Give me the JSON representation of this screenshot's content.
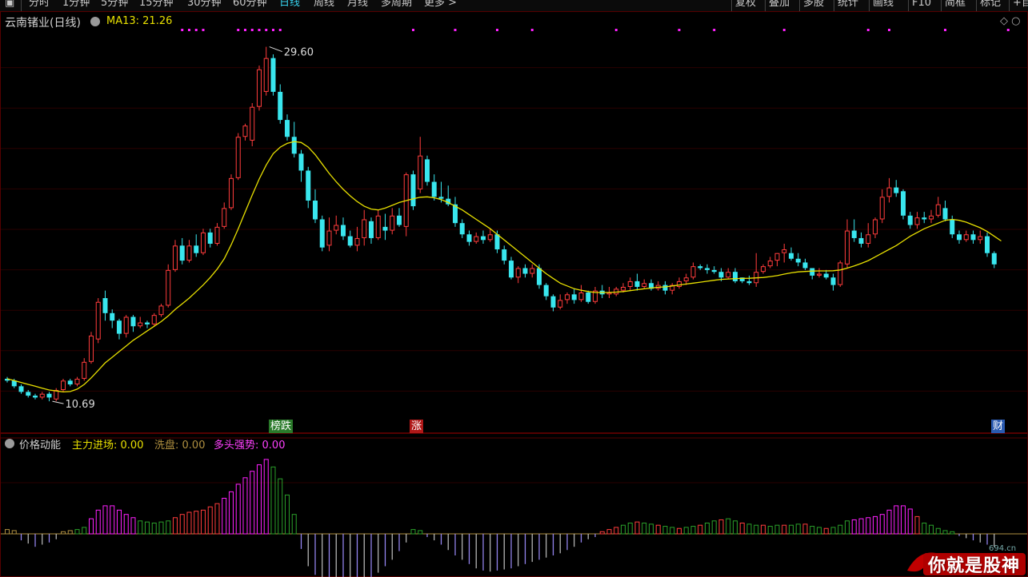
{
  "toolbar": {
    "left_items": [
      "分时",
      "1分钟",
      "5分钟",
      "15分钟",
      "30分钟",
      "60分钟",
      "日线",
      "周线",
      "月线",
      "多周期",
      "更多 >"
    ],
    "active": "日线",
    "right_items": [
      "复权",
      "叠加",
      "多股",
      "统计",
      "画线",
      "F10",
      "简框",
      "标记",
      "+自"
    ]
  },
  "chart": {
    "title": "云南锗业(日线)",
    "ma_label": "MA13: 21.26",
    "high_label": "29.60",
    "low_label": "10.69",
    "y_range": [
      9.0,
      31.5
    ],
    "colors": {
      "up": "#ff3c3c",
      "down": "#39e6ee",
      "ma": "#e8e000",
      "dot": "#ff20ff",
      "bg": "#000000",
      "grid": "#2a0000"
    },
    "corner_icons": "◇ ○"
  },
  "badges": [
    {
      "text": "榜跌",
      "bg": "#2a7a2a"
    },
    {
      "text": "涨",
      "bg": "#b01818"
    },
    {
      "text": "财",
      "bg": "#2a5ab0"
    }
  ],
  "indicator": {
    "name": "价格动能",
    "items": [
      {
        "label": "主力进场:",
        "value": "0.00",
        "color": "#e8e000"
      },
      {
        "label": "洗盘:",
        "value": "0.00",
        "color": "#b09040"
      },
      {
        "label": "多头强势:",
        "value": "0.00",
        "color": "#ff40ff"
      }
    ]
  },
  "chart_data": {
    "type": "candlestick",
    "title": "云南锗业(日线)",
    "series": [
      {
        "name": "MA13",
        "last": 21.26
      }
    ],
    "annotations": {
      "max": 29.6,
      "min": 10.69
    },
    "candles": [
      [
        11.9,
        11.8,
        12.0,
        11.7
      ],
      [
        11.8,
        11.5,
        11.9,
        11.4
      ],
      [
        11.5,
        11.2,
        11.6,
        11.1
      ],
      [
        11.2,
        11.0,
        11.3,
        10.9
      ],
      [
        11.0,
        10.9,
        11.1,
        10.8
      ],
      [
        10.9,
        11.1,
        11.2,
        10.8
      ],
      [
        11.1,
        10.9,
        11.2,
        10.7
      ],
      [
        10.8,
        11.3,
        11.4,
        10.7
      ],
      [
        11.3,
        11.8,
        11.9,
        11.2
      ],
      [
        11.8,
        11.6,
        11.9,
        11.5
      ],
      [
        11.6,
        11.9,
        12.0,
        11.5
      ],
      [
        11.9,
        12.8,
        13.0,
        11.8
      ],
      [
        12.8,
        14.2,
        14.4,
        12.7
      ],
      [
        14.0,
        16.0,
        16.2,
        13.8
      ],
      [
        16.2,
        15.4,
        16.6,
        15.0
      ],
      [
        15.4,
        15.0,
        15.6,
        14.6
      ],
      [
        15.0,
        14.3,
        15.1,
        14.0
      ],
      [
        14.3,
        15.2,
        15.3,
        14.1
      ],
      [
        15.2,
        14.7,
        15.3,
        14.4
      ],
      [
        14.7,
        14.9,
        15.2,
        14.6
      ],
      [
        14.9,
        14.8,
        15.0,
        14.6
      ],
      [
        14.8,
        15.3,
        15.4,
        14.7
      ],
      [
        15.3,
        15.8,
        15.9,
        15.2
      ],
      [
        15.8,
        17.7,
        18.0,
        15.7
      ],
      [
        17.7,
        19.0,
        19.3,
        17.6
      ],
      [
        19.0,
        18.2,
        19.4,
        18.0
      ],
      [
        18.2,
        19.0,
        19.3,
        18.1
      ],
      [
        19.0,
        18.6,
        19.6,
        18.4
      ],
      [
        18.6,
        19.7,
        19.9,
        18.5
      ],
      [
        19.7,
        19.1,
        19.9,
        18.9
      ],
      [
        19.1,
        20.0,
        20.2,
        19.0
      ],
      [
        20.0,
        21.0,
        21.3,
        19.9
      ],
      [
        21.0,
        22.6,
        22.8,
        20.9
      ],
      [
        22.6,
        24.8,
        25.0,
        22.5
      ],
      [
        24.8,
        25.4,
        25.5,
        24.6
      ],
      [
        24.6,
        26.4,
        26.6,
        24.3
      ],
      [
        26.4,
        28.4,
        28.6,
        26.2
      ],
      [
        27.2,
        29.0,
        29.6,
        27.0
      ],
      [
        29.0,
        27.2,
        29.2,
        27.0
      ],
      [
        27.2,
        25.7,
        27.6,
        25.5
      ],
      [
        25.7,
        24.8,
        26.0,
        24.6
      ],
      [
        24.8,
        23.9,
        25.6,
        23.7
      ],
      [
        23.9,
        23.0,
        24.1,
        22.4
      ],
      [
        23.0,
        21.4,
        23.2,
        21.0
      ],
      [
        21.4,
        20.4,
        22.0,
        20.2
      ],
      [
        20.4,
        18.9,
        20.6,
        18.7
      ],
      [
        19.0,
        19.8,
        20.5,
        18.7
      ],
      [
        19.8,
        20.1,
        20.6,
        19.6
      ],
      [
        20.1,
        19.5,
        20.5,
        19.3
      ],
      [
        19.5,
        19.0,
        19.8,
        18.9
      ],
      [
        19.0,
        19.4,
        20.0,
        18.7
      ],
      [
        19.4,
        20.4,
        20.9,
        19.0
      ],
      [
        20.3,
        19.4,
        20.5,
        19.1
      ],
      [
        19.4,
        20.6,
        20.9,
        19.3
      ],
      [
        20.0,
        19.8,
        20.7,
        19.3
      ],
      [
        19.8,
        20.6,
        21.0,
        19.6
      ],
      [
        20.6,
        20.1,
        21.0,
        20.0
      ],
      [
        20.0,
        22.8,
        22.9,
        19.5
      ],
      [
        22.8,
        21.1,
        23.0,
        20.9
      ],
      [
        22.0,
        23.8,
        24.8,
        21.8
      ],
      [
        23.6,
        22.4,
        23.8,
        22.2
      ],
      [
        22.4,
        21.6,
        22.8,
        21.4
      ],
      [
        21.6,
        21.5,
        22.4,
        21.3
      ],
      [
        21.5,
        21.2,
        22.2,
        21.1
      ],
      [
        21.2,
        20.2,
        21.6,
        20.0
      ],
      [
        20.2,
        19.6,
        20.4,
        19.4
      ],
      [
        19.6,
        19.2,
        19.8,
        19.0
      ],
      [
        19.2,
        19.5,
        19.7,
        19.1
      ],
      [
        19.5,
        19.3,
        19.8,
        19.1
      ],
      [
        19.3,
        19.6,
        19.9,
        19.2
      ],
      [
        19.6,
        18.8,
        19.8,
        18.6
      ],
      [
        18.8,
        18.2,
        19.0,
        18.0
      ],
      [
        18.2,
        17.3,
        18.4,
        17.2
      ],
      [
        17.3,
        17.8,
        17.9,
        17.0
      ],
      [
        17.8,
        17.5,
        18.0,
        17.3
      ],
      [
        17.5,
        17.8,
        18.0,
        17.3
      ],
      [
        17.8,
        16.9,
        18.0,
        16.7
      ],
      [
        16.9,
        16.3,
        17.0,
        16.1
      ],
      [
        16.3,
        15.7,
        16.4,
        15.5
      ],
      [
        15.7,
        16.1,
        16.4,
        15.6
      ],
      [
        16.1,
        16.4,
        16.5,
        15.9
      ],
      [
        16.4,
        16.1,
        16.7,
        15.9
      ],
      [
        16.1,
        16.5,
        16.9,
        16.0
      ],
      [
        16.5,
        16.0,
        16.6,
        15.9
      ],
      [
        16.0,
        16.6,
        16.8,
        15.9
      ],
      [
        16.6,
        16.4,
        16.9,
        16.2
      ],
      [
        16.4,
        16.5,
        16.8,
        16.2
      ],
      [
        16.4,
        16.7,
        16.8,
        16.3
      ],
      [
        16.6,
        16.8,
        17.0,
        16.5
      ],
      [
        16.8,
        17.1,
        17.3,
        16.6
      ],
      [
        17.1,
        16.8,
        17.5,
        16.6
      ],
      [
        16.8,
        17.0,
        17.2,
        16.7
      ],
      [
        17.0,
        16.7,
        17.2,
        16.6
      ],
      [
        16.7,
        16.9,
        17.1,
        16.6
      ],
      [
        16.9,
        16.6,
        17.1,
        16.4
      ],
      [
        16.6,
        16.9,
        17.0,
        16.4
      ],
      [
        16.8,
        17.1,
        17.3,
        16.7
      ],
      [
        17.1,
        17.3,
        17.5,
        16.9
      ],
      [
        17.3,
        17.9,
        18.1,
        17.2
      ],
      [
        17.9,
        17.8,
        18.0,
        17.7
      ],
      [
        17.8,
        17.7,
        18.0,
        17.5
      ],
      [
        17.7,
        17.6,
        17.9,
        17.5
      ],
      [
        17.6,
        17.3,
        17.8,
        17.1
      ],
      [
        17.3,
        17.6,
        17.8,
        17.2
      ],
      [
        17.6,
        17.1,
        17.8,
        17.0
      ],
      [
        17.3,
        17.1,
        17.3,
        17.0
      ],
      [
        17.1,
        17.0,
        17.4,
        16.9
      ],
      [
        17.0,
        17.6,
        18.6,
        16.8
      ],
      [
        17.6,
        17.9,
        18.0,
        17.5
      ],
      [
        17.9,
        18.2,
        18.4,
        17.8
      ],
      [
        18.2,
        18.6,
        18.6,
        17.9
      ],
      [
        18.6,
        18.8,
        19.1,
        18.1
      ],
      [
        18.6,
        18.3,
        18.9,
        18.2
      ],
      [
        18.3,
        18.1,
        18.6,
        17.9
      ],
      [
        18.1,
        17.8,
        18.3,
        17.7
      ],
      [
        17.8,
        17.4,
        17.8,
        17.2
      ],
      [
        17.4,
        17.5,
        17.8,
        17.3
      ],
      [
        17.5,
        17.3,
        17.7,
        17.2
      ],
      [
        17.3,
        16.9,
        17.5,
        16.6
      ],
      [
        16.9,
        18.1,
        18.2,
        16.8
      ],
      [
        18.0,
        19.8,
        20.4,
        17.8
      ],
      [
        19.8,
        19.4,
        20.4,
        19.2
      ],
      [
        19.4,
        19.1,
        19.7,
        18.9
      ],
      [
        19.1,
        19.6,
        20.2,
        18.9
      ],
      [
        19.6,
        20.4,
        20.5,
        19.4
      ],
      [
        20.4,
        21.6,
        22.0,
        20.2
      ],
      [
        21.6,
        22.1,
        22.6,
        21.3
      ],
      [
        22.1,
        21.8,
        22.5,
        21.6
      ],
      [
        21.9,
        20.6,
        22.0,
        20.4
      ],
      [
        20.6,
        20.1,
        20.8,
        19.9
      ],
      [
        20.1,
        20.5,
        20.8,
        19.9
      ],
      [
        20.5,
        20.4,
        20.8,
        20.2
      ],
      [
        20.4,
        20.6,
        20.9,
        20.2
      ],
      [
        20.6,
        21.2,
        21.6,
        20.5
      ],
      [
        21.0,
        20.4,
        21.4,
        20.3
      ],
      [
        20.4,
        19.6,
        20.6,
        19.4
      ],
      [
        19.6,
        19.3,
        19.8,
        19.1
      ],
      [
        19.3,
        19.6,
        19.8,
        19.2
      ],
      [
        19.6,
        19.3,
        19.8,
        19.1
      ],
      [
        19.3,
        19.5,
        19.8,
        19.1
      ],
      [
        19.5,
        18.6,
        19.7,
        18.4
      ],
      [
        18.6,
        18.0,
        18.7,
        17.8
      ]
    ],
    "ma13": [
      11.9,
      11.8,
      11.7,
      11.6,
      11.5,
      11.4,
      11.3,
      11.25,
      11.2,
      11.22,
      11.35,
      11.6,
      11.95,
      12.35,
      12.75,
      13.05,
      13.35,
      13.65,
      13.95,
      14.2,
      14.45,
      14.7,
      14.95,
      15.25,
      15.6,
      15.9,
      16.2,
      16.55,
      16.9,
      17.3,
      17.75,
      18.3,
      19.05,
      19.9,
      20.8,
      21.7,
      22.55,
      23.3,
      23.9,
      24.25,
      24.45,
      24.55,
      24.5,
      24.25,
      23.85,
      23.35,
      22.85,
      22.4,
      22.0,
      21.65,
      21.35,
      21.1,
      20.95,
      20.9,
      21.0,
      21.15,
      21.3,
      21.4,
      21.5,
      21.58,
      21.6,
      21.55,
      21.45,
      21.3,
      21.1,
      20.9,
      20.65,
      20.4,
      20.15,
      19.9,
      19.6,
      19.3,
      19.0,
      18.7,
      18.4,
      18.1,
      17.8,
      17.5,
      17.25,
      17.0,
      16.85,
      16.7,
      16.62,
      16.55,
      16.5,
      16.5,
      16.5,
      16.52,
      16.55,
      16.6,
      16.65,
      16.7,
      16.74,
      16.78,
      16.8,
      16.85,
      16.9,
      16.95,
      17.0,
      17.05,
      17.1,
      17.15,
      17.2,
      17.22,
      17.24,
      17.25,
      17.26,
      17.28,
      17.3,
      17.35,
      17.4,
      17.48,
      17.55,
      17.6,
      17.62,
      17.64,
      17.65,
      17.65,
      17.66,
      17.7,
      17.8,
      17.92,
      18.05,
      18.2,
      18.4,
      18.6,
      18.8,
      19.0,
      19.25,
      19.5,
      19.7,
      19.9,
      20.05,
      20.2,
      20.35,
      20.4,
      20.35,
      20.25,
      20.1,
      19.95,
      19.75,
      19.5,
      19.25
    ],
    "indicator_bars": [
      0.4,
      0.3,
      -0.6,
      -0.9,
      -1.2,
      -1.0,
      -0.8,
      -0.5,
      0.2,
      0.3,
      0.4,
      0.6,
      1.4,
      2.2,
      2.6,
      2.6,
      2.2,
      1.8,
      1.5,
      1.2,
      1.1,
      1.0,
      1.1,
      1.2,
      1.5,
      1.8,
      2.0,
      2.1,
      2.2,
      2.5,
      2.8,
      3.3,
      3.9,
      4.6,
      5.2,
      5.8,
      6.4,
      6.9,
      6.2,
      5.1,
      3.6,
      1.8,
      -1.4,
      -3.0,
      -3.8,
      -4.2,
      -4.4,
      -4.6,
      -4.6,
      -4.5,
      -4.4,
      -4.3,
      -4.0,
      -3.6,
      -3.0,
      -2.4,
      -1.6,
      -0.8,
      0.4,
      0.3,
      -0.3,
      -0.6,
      -1.0,
      -1.5,
      -2.0,
      -2.4,
      -2.8,
      -3.2,
      -3.4,
      -3.5,
      -3.4,
      -3.3,
      -3.2,
      -3.0,
      -2.8,
      -2.6,
      -2.4,
      -2.2,
      -2.0,
      -1.8,
      -1.5,
      -1.2,
      -0.8,
      -0.5,
      -0.3,
      0.2,
      0.4,
      0.6,
      0.8,
      1.0,
      1.1,
      1.0,
      0.9,
      0.8,
      0.7,
      0.6,
      0.5,
      0.6,
      0.7,
      0.8,
      1.0,
      1.2,
      1.3,
      1.4,
      1.2,
      1.0,
      0.9,
      0.8,
      0.8,
      0.7,
      0.8,
      0.8,
      0.8,
      0.9,
      0.9,
      0.7,
      0.6,
      0.5,
      0.6,
      0.8,
      1.2,
      1.3,
      1.4,
      1.5,
      1.6,
      1.8,
      2.2,
      2.6,
      2.6,
      2.3,
      1.6,
      1.0,
      0.8,
      0.5,
      0.3,
      0.2,
      -0.2,
      -0.4,
      -0.6,
      -0.8,
      -1.0,
      -1.2
    ],
    "indicator_colors": {
      "up_strong": "#ff20ff",
      "up_weak_red": "#ff3c3c",
      "up_green": "#2aa02a",
      "down": "#9c8cff",
      "down_grey": "#c0c0c0",
      "base": "#b09040"
    }
  }
}
